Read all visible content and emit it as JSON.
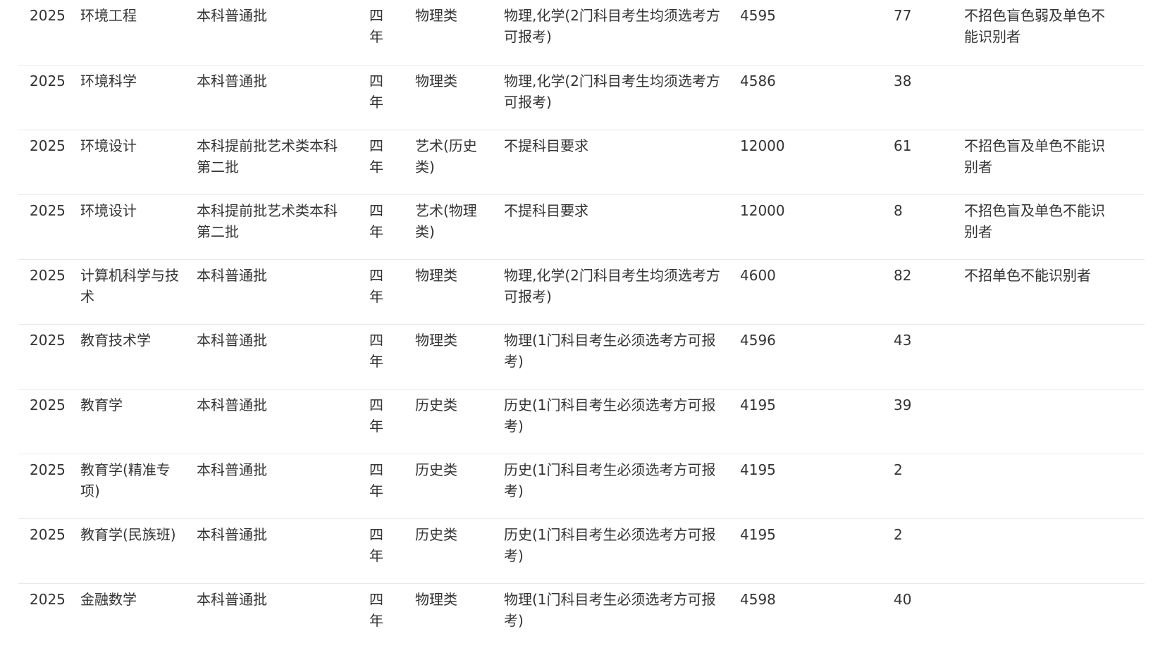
{
  "rows": [
    {
      "year": "2025",
      "major": "环境工程",
      "batch": "本科普通批",
      "duration": "四年",
      "subject_type": "物理类",
      "requirement": "物理,化学(2门科目考生均须选考方可报考)",
      "fee": "4595",
      "plan": "77",
      "note": "不招色盲色弱及单色不能识别者"
    },
    {
      "year": "2025",
      "major": "环境科学",
      "batch": "本科普通批",
      "duration": "四年",
      "subject_type": "物理类",
      "requirement": "物理,化学(2门科目考生均须选考方可报考)",
      "fee": "4586",
      "plan": "38",
      "note": ""
    },
    {
      "year": "2025",
      "major": "环境设计",
      "batch": "本科提前批艺术类本科第二批",
      "duration": "四年",
      "subject_type": "艺术(历史类)",
      "requirement": "不提科目要求",
      "fee": "12000",
      "plan": "61",
      "note": "不招色盲及单色不能识别者"
    },
    {
      "year": "2025",
      "major": "环境设计",
      "batch": "本科提前批艺术类本科第二批",
      "duration": "四年",
      "subject_type": "艺术(物理类)",
      "requirement": "不提科目要求",
      "fee": "12000",
      "plan": "8",
      "note": "不招色盲及单色不能识别者"
    },
    {
      "year": "2025",
      "major": "计算机科学与技术",
      "batch": "本科普通批",
      "duration": "四年",
      "subject_type": "物理类",
      "requirement": "物理,化学(2门科目考生均须选考方可报考)",
      "fee": "4600",
      "plan": "82",
      "note": "不招单色不能识别者"
    },
    {
      "year": "2025",
      "major": "教育技术学",
      "batch": "本科普通批",
      "duration": "四年",
      "subject_type": "物理类",
      "requirement": "物理(1门科目考生必须选考方可报考)",
      "fee": "4596",
      "plan": "43",
      "note": ""
    },
    {
      "year": "2025",
      "major": "教育学",
      "batch": "本科普通批",
      "duration": "四年",
      "subject_type": "历史类",
      "requirement": "历史(1门科目考生必须选考方可报考)",
      "fee": "4195",
      "plan": "39",
      "note": ""
    },
    {
      "year": "2025",
      "major": "教育学(精准专项)",
      "batch": "本科普通批",
      "duration": "四年",
      "subject_type": "历史类",
      "requirement": "历史(1门科目考生必须选考方可报考)",
      "fee": "4195",
      "plan": "2",
      "note": ""
    },
    {
      "year": "2025",
      "major": "教育学(民族班)",
      "batch": "本科普通批",
      "duration": "四年",
      "subject_type": "历史类",
      "requirement": "历史(1门科目考生必须选考方可报考)",
      "fee": "4195",
      "plan": "2",
      "note": ""
    },
    {
      "year": "2025",
      "major": "金融数学",
      "batch": "本科普通批",
      "duration": "四年",
      "subject_type": "物理类",
      "requirement": "物理(1门科目考生必须选考方可报考)",
      "fee": "4598",
      "plan": "40",
      "note": ""
    }
  ]
}
